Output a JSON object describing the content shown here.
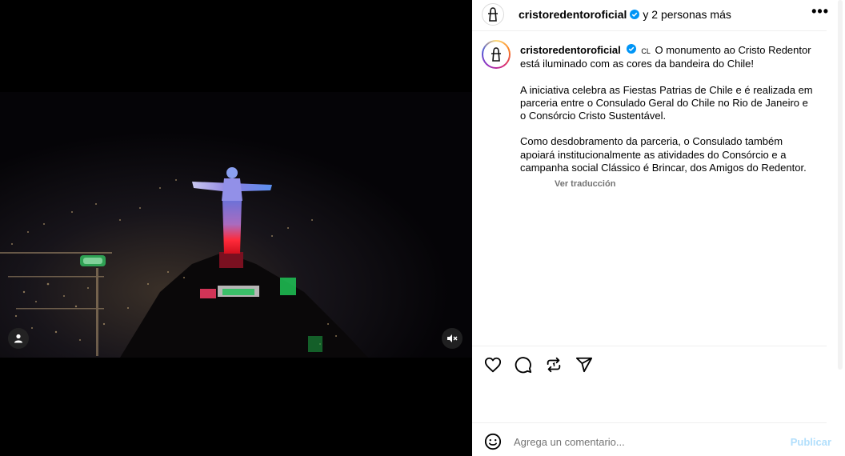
{
  "post": {
    "header": {
      "username": "cristoredentoroficial",
      "collaborators": "y 2 personas más",
      "more_label": "•••"
    },
    "caption": {
      "username": "cristoredentoroficial",
      "flag_code": "CL",
      "paragraphs": [
        "O monumento ao Cristo Redentor está iluminado com as cores da bandeira do Chile!",
        "A iniciativa celebra as Fiestas Patrias de Chile e é realizada em parceria entre o Consulado Geral do Chile no Rio de Janeiro e o Consórcio Cristo Sustentável.",
        "Como desdobramento da parceria, o Consulado também apoiará institucionalmente as atividades do Consórcio e a campanha social Clássico é Brincar, dos Amigos do Redentor."
      ],
      "see_translation": "Ver traducción"
    },
    "comment": {
      "placeholder": "Agrega un comentario...",
      "publish_label": "Publicar"
    }
  },
  "icons": {
    "verified": "verified-badge-icon",
    "like": "heart-icon",
    "comment": "comment-icon",
    "repost": "repost-icon",
    "share": "share-icon",
    "emoji": "emoji-icon",
    "user_tag": "person-icon",
    "mute": "speaker-muted-icon"
  },
  "colors": {
    "verified_blue": "#0095f6",
    "publish_disabled": "#b2dffc",
    "muted_text": "#737373"
  }
}
